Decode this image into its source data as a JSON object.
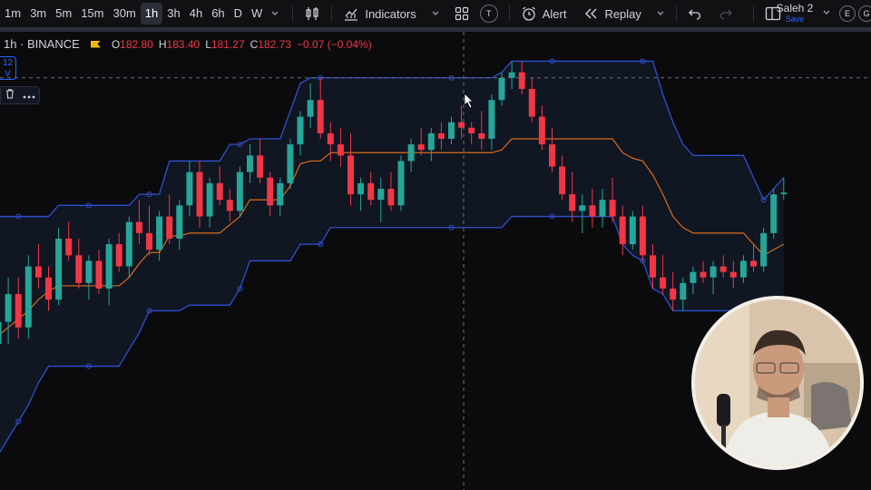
{
  "toolbar": {
    "timeframes": [
      "1m",
      "3m",
      "5m",
      "15m",
      "30m",
      "1h",
      "3h",
      "4h",
      "6h",
      "D",
      "W"
    ],
    "active_timeframe": "1h",
    "indicators_label": "Indicators",
    "templates_badge": "T",
    "alert_label": "Alert",
    "replay_label": "Replay",
    "user_name": "Saleh 2",
    "save_label": "Save",
    "circle_e": "E",
    "circle_g": "G"
  },
  "legend": {
    "symbol": "1h · BINANCE",
    "o_label": "O",
    "o_value": "182.80",
    "h_label": "H",
    "h_value": "183.40",
    "l_label": "L",
    "l_value": "181.27",
    "c_label": "C",
    "c_value": "182.73",
    "change": "−0.07 (−0.04%)"
  },
  "badge": {
    "line1": "12",
    "line2": "V"
  },
  "colors": {
    "up": "#26a69a",
    "down": "#f23645",
    "donchian_band": "#2f4fd0",
    "basis": "#d96b1e",
    "background": "#0b0b0d",
    "accent": "#2962ff"
  },
  "chart_data": {
    "type": "candlestick",
    "indicator": "Donchian Channels",
    "candles_ohlc": [
      [
        180.0,
        180.6,
        179.6,
        180.4
      ],
      [
        180.4,
        181.2,
        180.0,
        180.9
      ],
      [
        180.9,
        181.2,
        180.1,
        180.3
      ],
      [
        180.3,
        181.6,
        180.1,
        181.4
      ],
      [
        181.4,
        181.8,
        181.0,
        181.2
      ],
      [
        181.2,
        181.4,
        180.6,
        180.8
      ],
      [
        180.8,
        182.1,
        180.7,
        181.9
      ],
      [
        181.9,
        182.2,
        181.5,
        181.6
      ],
      [
        181.6,
        181.9,
        181.0,
        181.1
      ],
      [
        181.1,
        181.6,
        180.8,
        181.5
      ],
      [
        181.5,
        181.7,
        180.9,
        181.0
      ],
      [
        181.0,
        181.9,
        180.7,
        181.8
      ],
      [
        181.8,
        182.0,
        181.3,
        181.4
      ],
      [
        181.4,
        182.3,
        181.2,
        182.2
      ],
      [
        182.2,
        182.6,
        181.8,
        182.0
      ],
      [
        182.0,
        182.5,
        181.6,
        181.7
      ],
      [
        181.7,
        182.4,
        181.5,
        182.3
      ],
      [
        182.3,
        182.7,
        181.8,
        181.9
      ],
      [
        181.9,
        182.6,
        181.7,
        182.5
      ],
      [
        182.5,
        183.3,
        182.3,
        183.1
      ],
      [
        183.1,
        183.3,
        182.1,
        182.3
      ],
      [
        182.3,
        183.0,
        182.1,
        182.9
      ],
      [
        182.9,
        183.2,
        182.5,
        182.6
      ],
      [
        182.6,
        182.8,
        182.2,
        182.4
      ],
      [
        182.4,
        183.2,
        182.3,
        183.1
      ],
      [
        183.1,
        183.6,
        182.9,
        183.4
      ],
      [
        183.4,
        183.7,
        182.9,
        183.0
      ],
      [
        183.0,
        183.1,
        182.3,
        182.5
      ],
      [
        182.5,
        183.0,
        182.3,
        182.9
      ],
      [
        182.9,
        183.7,
        182.8,
        183.6
      ],
      [
        183.6,
        184.2,
        183.4,
        184.1
      ],
      [
        184.1,
        184.7,
        183.9,
        184.4
      ],
      [
        184.4,
        184.8,
        183.7,
        183.8
      ],
      [
        183.8,
        184.0,
        183.3,
        183.6
      ],
      [
        183.6,
        183.9,
        183.2,
        183.4
      ],
      [
        183.4,
        183.8,
        182.5,
        182.7
      ],
      [
        182.7,
        183.0,
        182.4,
        182.9
      ],
      [
        182.9,
        183.1,
        182.5,
        182.6
      ],
      [
        182.6,
        183.0,
        182.2,
        182.8
      ],
      [
        182.8,
        183.1,
        182.4,
        182.5
      ],
      [
        182.5,
        183.4,
        182.4,
        183.3
      ],
      [
        183.3,
        183.7,
        183.1,
        183.6
      ],
      [
        183.6,
        183.9,
        183.4,
        183.5
      ],
      [
        183.5,
        183.9,
        183.3,
        183.8
      ],
      [
        183.8,
        184.0,
        183.5,
        183.7
      ],
      [
        183.7,
        184.1,
        183.6,
        184.0
      ],
      [
        184.0,
        184.3,
        183.7,
        183.9
      ],
      [
        183.9,
        184.0,
        183.6,
        183.8
      ],
      [
        183.8,
        184.2,
        183.5,
        183.7
      ],
      [
        183.7,
        184.5,
        183.5,
        184.4
      ],
      [
        184.4,
        184.9,
        184.3,
        184.8
      ],
      [
        184.8,
        185.1,
        184.6,
        184.9
      ],
      [
        184.9,
        185.1,
        184.5,
        184.6
      ],
      [
        184.6,
        184.8,
        184.0,
        184.1
      ],
      [
        184.1,
        184.3,
        183.5,
        183.6
      ],
      [
        183.6,
        183.9,
        183.1,
        183.2
      ],
      [
        183.2,
        183.4,
        182.6,
        182.7
      ],
      [
        182.7,
        183.1,
        182.2,
        182.4
      ],
      [
        182.4,
        182.7,
        182.0,
        182.5
      ],
      [
        182.5,
        182.8,
        182.1,
        182.3
      ],
      [
        182.3,
        182.8,
        182.1,
        182.6
      ],
      [
        182.6,
        183.0,
        182.2,
        182.3
      ],
      [
        182.3,
        182.5,
        181.6,
        181.8
      ],
      [
        181.8,
        182.4,
        181.7,
        182.3
      ],
      [
        182.3,
        182.5,
        181.5,
        181.6
      ],
      [
        181.6,
        181.8,
        181.0,
        181.2
      ],
      [
        181.2,
        181.6,
        180.9,
        181.0
      ],
      [
        181.0,
        181.3,
        180.6,
        180.8
      ],
      [
        180.8,
        181.2,
        180.6,
        181.1
      ],
      [
        181.1,
        181.4,
        180.9,
        181.3
      ],
      [
        181.3,
        181.5,
        181.1,
        181.2
      ],
      [
        181.2,
        181.5,
        180.9,
        181.4
      ],
      [
        181.4,
        181.6,
        181.2,
        181.3
      ],
      [
        181.3,
        181.5,
        181.0,
        181.2
      ],
      [
        181.2,
        181.6,
        181.1,
        181.5
      ],
      [
        181.5,
        181.8,
        181.3,
        181.4
      ],
      [
        181.4,
        182.1,
        181.3,
        182.0
      ],
      [
        182.0,
        182.8,
        181.9,
        182.7
      ],
      [
        182.7,
        183.0,
        182.6,
        182.73
      ]
    ],
    "donchian_upper": [
      182.3,
      182.3,
      182.3,
      182.3,
      182.3,
      182.3,
      182.5,
      182.5,
      182.5,
      182.5,
      182.5,
      182.5,
      182.5,
      182.5,
      182.7,
      182.7,
      182.7,
      183.3,
      183.3,
      183.3,
      183.3,
      183.3,
      183.3,
      183.6,
      183.6,
      183.7,
      183.7,
      183.7,
      183.7,
      184.2,
      184.7,
      184.8,
      184.8,
      184.8,
      184.8,
      184.8,
      184.8,
      184.8,
      184.8,
      184.8,
      184.8,
      184.8,
      184.8,
      184.8,
      184.8,
      184.8,
      184.8,
      184.8,
      184.8,
      184.8,
      184.9,
      185.1,
      185.1,
      185.1,
      185.1,
      185.1,
      185.1,
      185.1,
      185.1,
      185.1,
      185.1,
      185.1,
      185.1,
      185.1,
      185.1,
      185.1,
      184.5,
      184.0,
      183.6,
      183.4,
      183.4,
      183.4,
      183.4,
      183.4,
      183.4,
      183.0,
      182.6,
      182.8,
      183.0
    ],
    "donchian_lower": [
      178.0,
      178.3,
      178.6,
      178.9,
      179.3,
      179.6,
      179.6,
      179.6,
      179.6,
      179.6,
      179.6,
      179.6,
      179.6,
      179.9,
      180.2,
      180.6,
      180.6,
      180.6,
      180.6,
      180.7,
      180.7,
      180.7,
      180.7,
      180.7,
      181.0,
      181.5,
      181.5,
      181.5,
      181.5,
      181.5,
      181.8,
      181.8,
      181.8,
      182.1,
      182.1,
      182.1,
      182.1,
      182.1,
      182.1,
      182.1,
      182.1,
      182.1,
      182.1,
      182.1,
      182.1,
      182.1,
      182.1,
      182.1,
      182.1,
      182.1,
      182.1,
      182.3,
      182.3,
      182.3,
      182.3,
      182.3,
      182.3,
      182.3,
      182.3,
      182.3,
      182.3,
      182.3,
      181.8,
      181.6,
      181.5,
      181.0,
      180.9,
      180.6,
      180.6,
      180.6,
      180.6,
      180.6,
      180.6,
      180.6,
      180.6,
      180.6,
      180.6,
      180.6,
      180.6
    ],
    "crosshair_price": 184.8,
    "y_range": [
      177.4,
      185.5
    ]
  }
}
